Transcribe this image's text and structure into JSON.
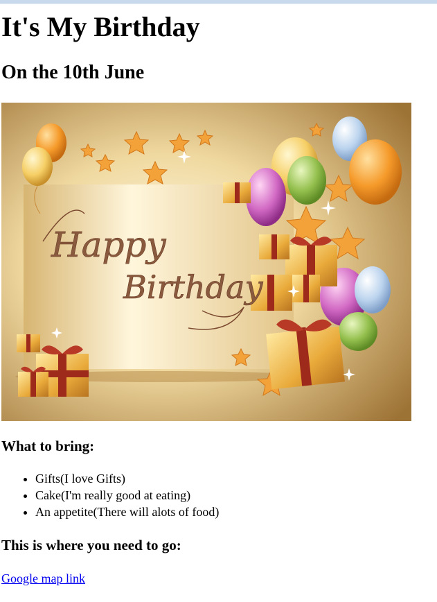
{
  "page": {
    "title": "It's My Birthday",
    "date_heading": "On the 10th June"
  },
  "image": {
    "script_line1": "Happy",
    "script_line2": "Birthday"
  },
  "bring": {
    "heading": "What to bring:",
    "items": [
      "Gifts(I love Gifts)",
      "Cake(I'm really good at eating)",
      "An appetite(There will alots of food)"
    ]
  },
  "directions": {
    "heading": "This is where you need to go:",
    "link_label": "Google map link"
  },
  "colors": {
    "link": "#0000ee",
    "gold_light": "#fbf2d6",
    "gold_dark": "#a87a32",
    "ribbon": "#9e2a1c"
  }
}
